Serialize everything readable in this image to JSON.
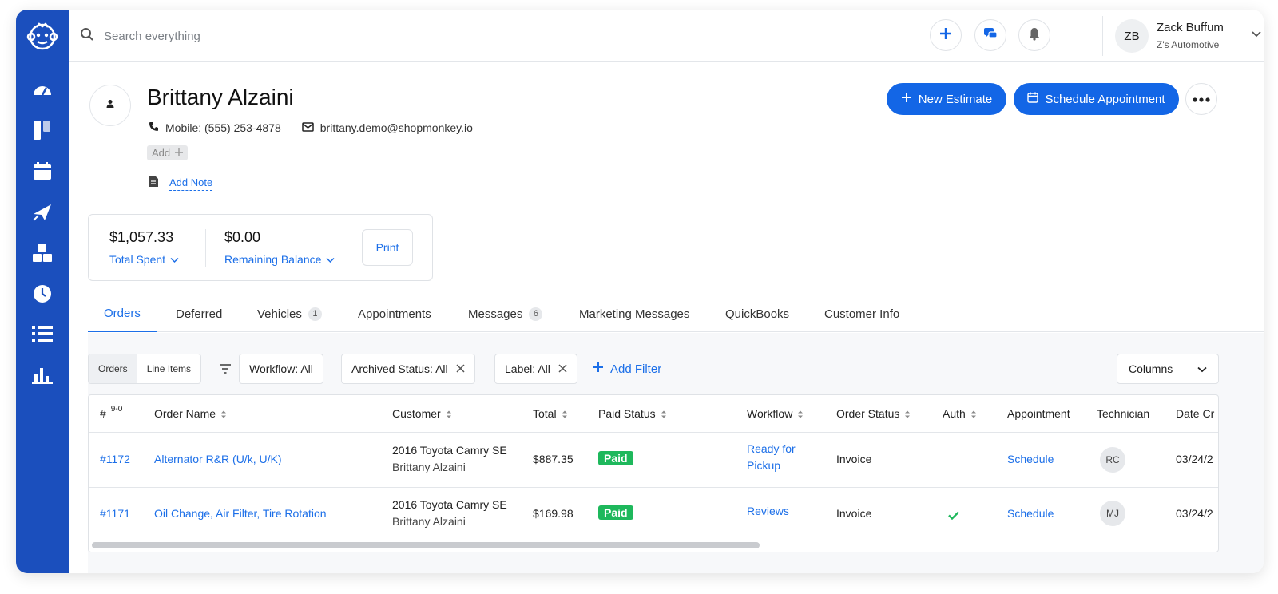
{
  "topbar": {
    "search_placeholder": "Search everything",
    "user_initials": "ZB",
    "user_name": "Zack Buffum",
    "user_org": "Z's Automotive"
  },
  "sidebar": {
    "icons": [
      "logo-icon",
      "dashboard-icon",
      "board-icon",
      "calendar-icon",
      "marketing-icon",
      "inventory-icon",
      "clock-icon",
      "list-icon",
      "reports-icon"
    ]
  },
  "customer": {
    "name": "Brittany Alzaini",
    "phone": "Mobile: (555) 253-4878",
    "email": "brittany.demo@shopmonkey.io",
    "add_tag": "Add",
    "add_note": "Add Note"
  },
  "actions": {
    "new_estimate": "New Estimate",
    "schedule_appointment": "Schedule Appointment"
  },
  "summary": {
    "total_spent_amount": "$1,057.33",
    "total_spent_label": "Total Spent",
    "remaining_amount": "$0.00",
    "remaining_label": "Remaining Balance",
    "print": "Print"
  },
  "tabs": [
    {
      "label": "Orders",
      "active": true
    },
    {
      "label": "Deferred"
    },
    {
      "label": "Vehicles",
      "badge": "1"
    },
    {
      "label": "Appointments"
    },
    {
      "label": "Messages",
      "badge": "6"
    },
    {
      "label": "Marketing Messages"
    },
    {
      "label": "QuickBooks"
    },
    {
      "label": "Customer Info"
    }
  ],
  "toolbar": {
    "seg_orders": "Orders",
    "seg_line_items": "Line Items",
    "workflow_key": "Workflow:",
    "workflow_val": "All",
    "archived_key": "Archived Status:",
    "archived_val": "All",
    "label_key": "Label:",
    "label_val": "All",
    "add_filter": "Add Filter",
    "columns": "Columns"
  },
  "table": {
    "headers": {
      "num": "#",
      "num_sort": "9-0",
      "order_name": "Order Name",
      "customer": "Customer",
      "total": "Total",
      "paid_status": "Paid Status",
      "workflow": "Workflow",
      "order_status": "Order Status",
      "auth": "Auth",
      "appointment": "Appointment",
      "technician": "Technician",
      "date_created": "Date Cr"
    },
    "rows": [
      {
        "num": "#1172",
        "order_name": "Alternator R&R (U/k, U/K)",
        "vehicle": "2016 Toyota Camry SE",
        "customer": "Brittany Alzaini",
        "total": "$887.35",
        "paid": "Paid",
        "workflow_line1": "Ready for",
        "workflow_line2": "Pickup",
        "order_status": "Invoice",
        "auth": "",
        "appointment": "Schedule",
        "technician": "RC",
        "date": "03/24/2"
      },
      {
        "num": "#1171",
        "order_name": "Oil Change, Air Filter, Tire Rotation",
        "vehicle": "2016 Toyota Camry SE",
        "customer": "Brittany Alzaini",
        "total": "$169.98",
        "paid": "Paid",
        "workflow_line1": "Reviews",
        "order_status": "Invoice",
        "auth": "check",
        "appointment": "Schedule",
        "technician": "MJ",
        "date": "03/24/2"
      }
    ]
  },
  "colors": {
    "sidebar": "#1b4fbd",
    "primary": "#1366e6",
    "link": "#1c6fe8",
    "paid": "#1eb85c"
  }
}
